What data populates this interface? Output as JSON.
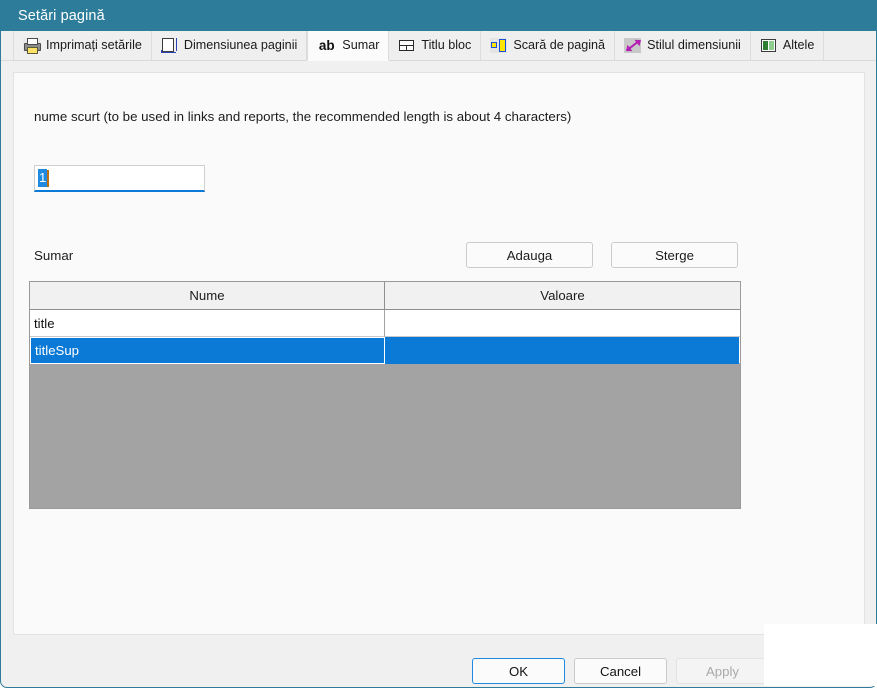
{
  "window": {
    "title": "Setări pagină"
  },
  "tabs": [
    {
      "label": "Imprimați setările",
      "icon": "printer-icon",
      "active": false
    },
    {
      "label": "Dimensiunea paginii",
      "icon": "page-size-icon",
      "active": false
    },
    {
      "label": "Sumar",
      "icon": "ab-text-icon",
      "active": true
    },
    {
      "label": "Titlu bloc",
      "icon": "title-block-icon",
      "active": false
    },
    {
      "label": "Scară de pagină",
      "icon": "page-scale-icon",
      "active": false
    },
    {
      "label": "Stilul dimensiunii",
      "icon": "dimension-style-icon",
      "active": false
    },
    {
      "label": "Altele",
      "icon": "others-image-icon",
      "active": false
    }
  ],
  "content": {
    "description": "nume scurt (to be used in links and reports, the recommended length is about 4 characters)",
    "short_name_input": {
      "value": "1",
      "placeholder": "",
      "selected": true
    },
    "section_label": "Sumar",
    "buttons": {
      "add": "Adauga",
      "delete": "Sterge"
    },
    "table": {
      "columns": [
        "Nume",
        "Valoare"
      ],
      "rows": [
        {
          "name": "title",
          "value": "",
          "selected": false
        },
        {
          "name": "titleSup",
          "value": "",
          "selected": true
        }
      ]
    }
  },
  "footer": {
    "ok": "OK",
    "cancel": "Cancel",
    "apply": "Apply",
    "apply_disabled": true
  },
  "colors": {
    "titlebar": "#2d7d9a",
    "selection": "#0a7ad6",
    "accent_focus": "#1f8ae0",
    "grid_empty": "#a3a3a3",
    "panel": "#fafafa"
  }
}
